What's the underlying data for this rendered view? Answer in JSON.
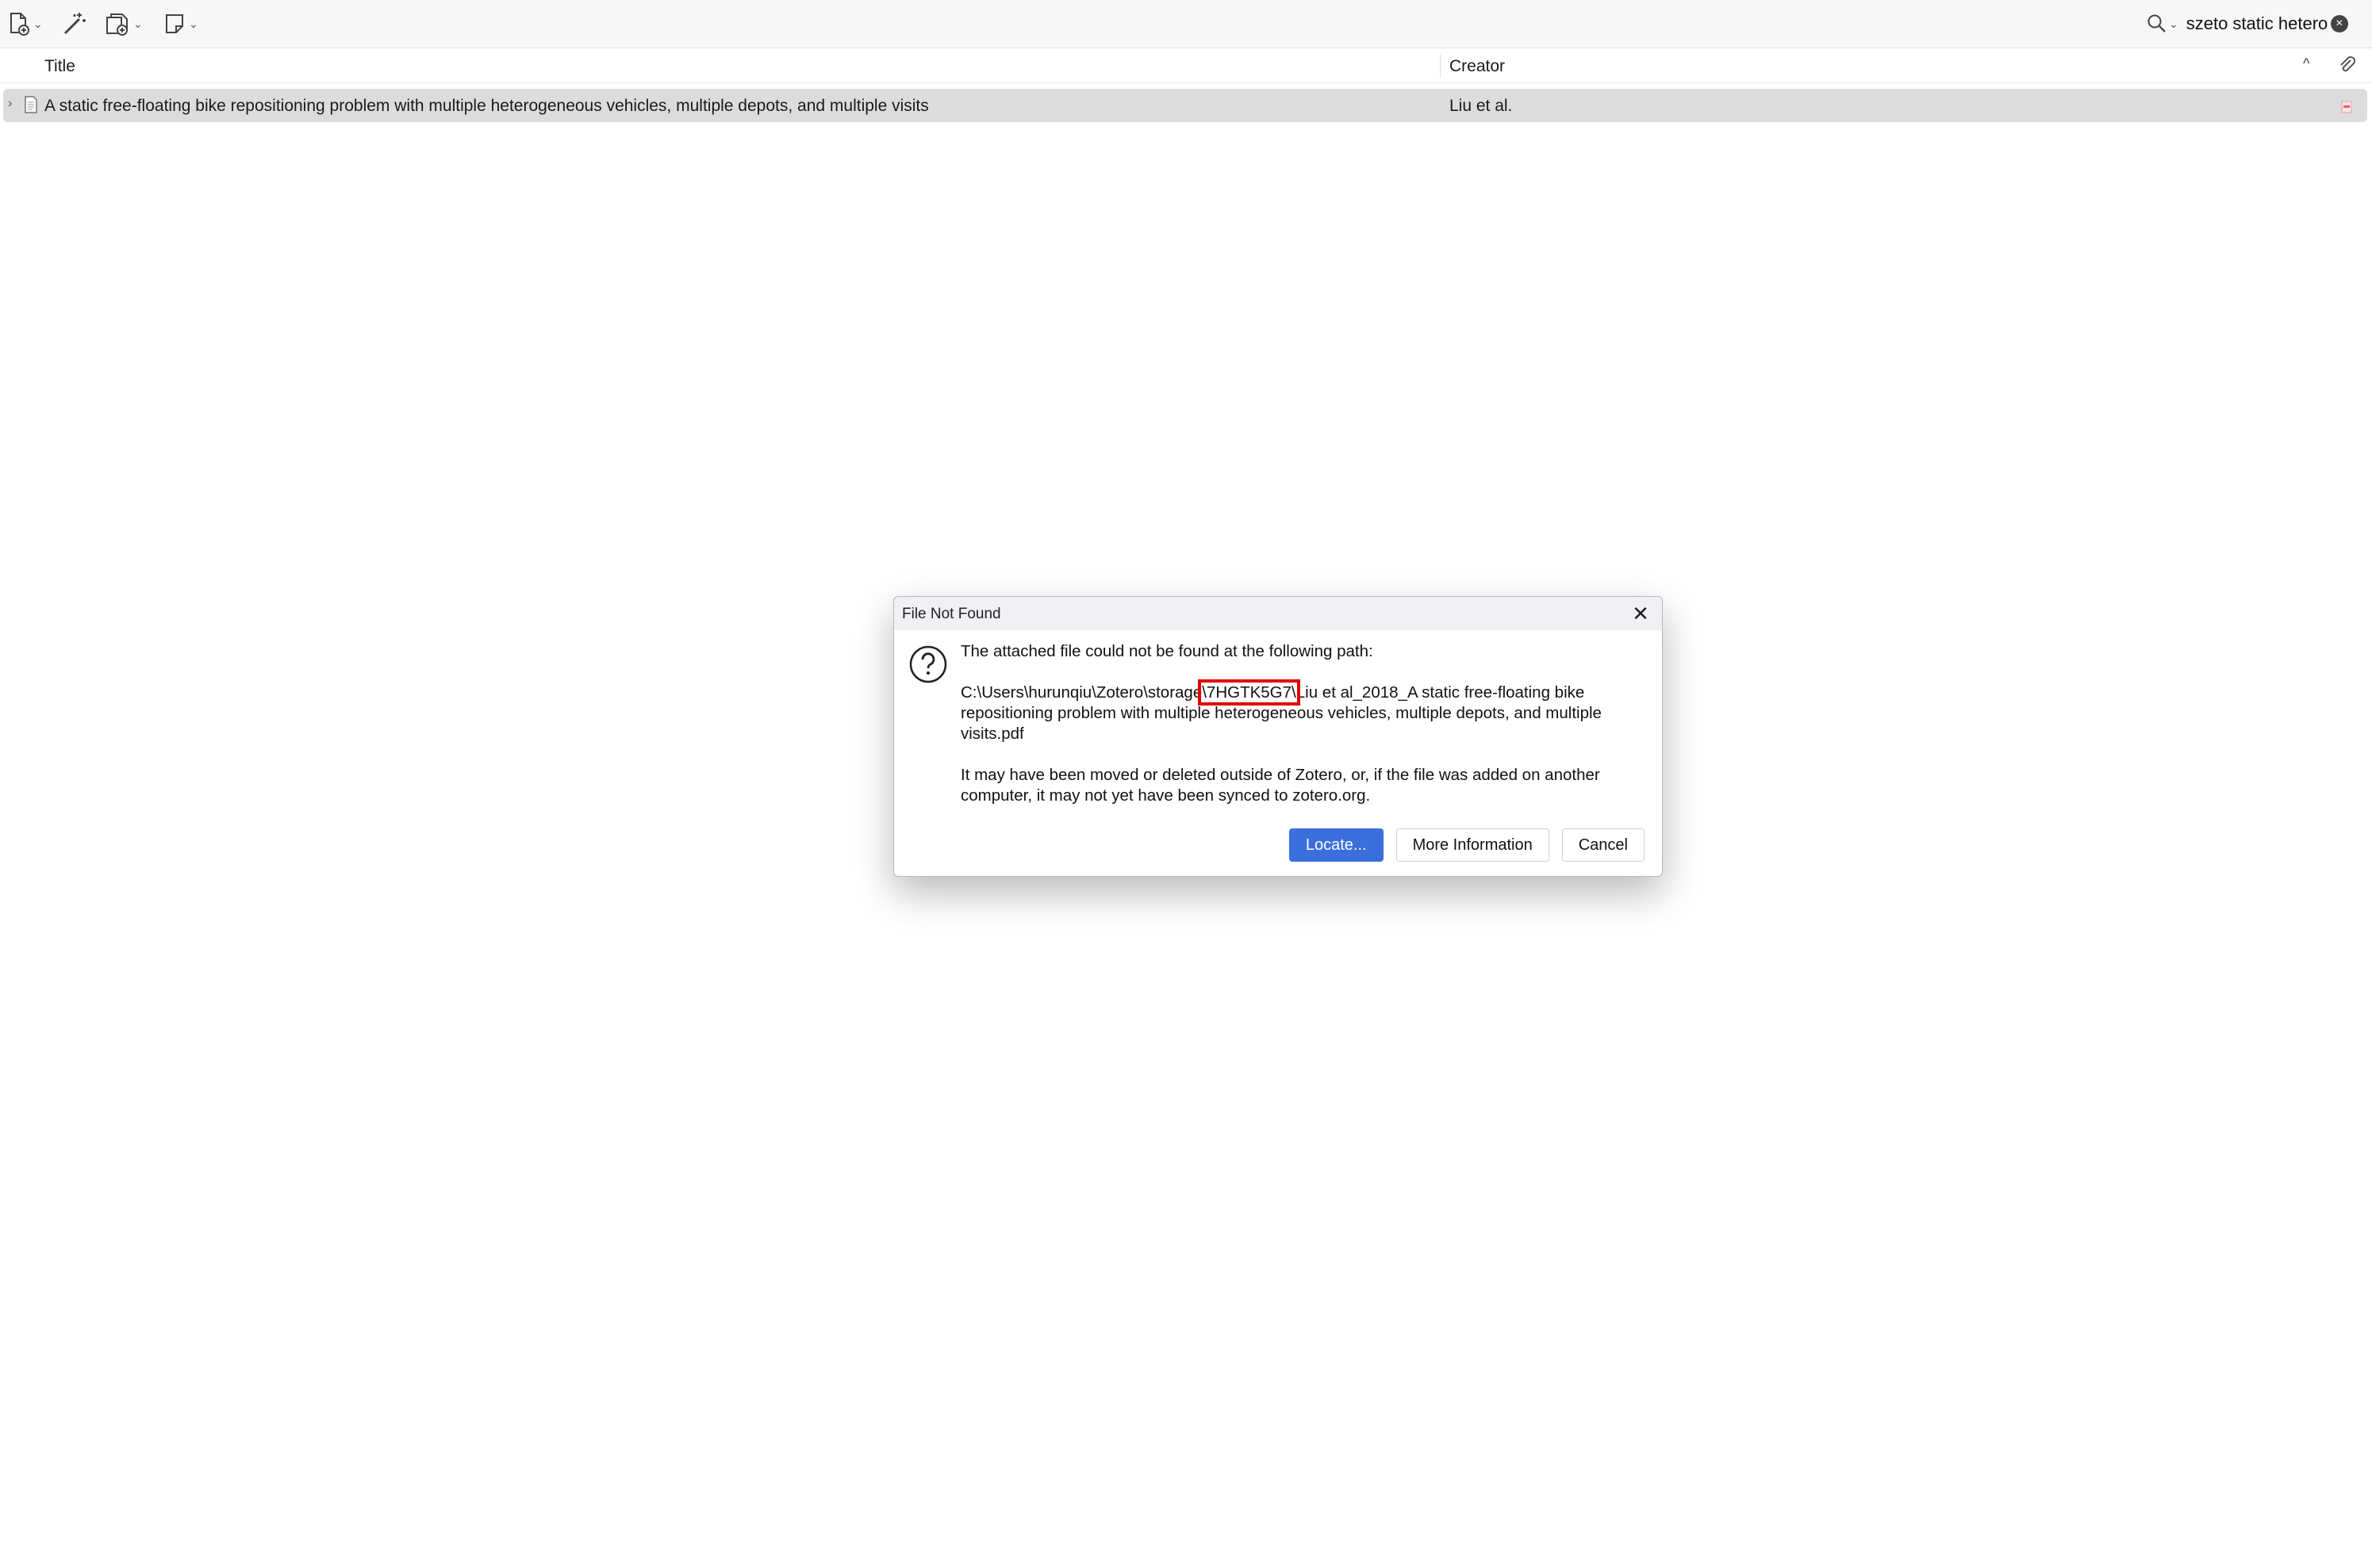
{
  "toolbar": {
    "new_item_icon": "new-item-icon",
    "magic_wand_icon": "add-by-identifier-icon",
    "new_attachment_icon": "add-attachment-icon",
    "new_note_icon": "new-note-icon",
    "search_value": "szeto static hetero"
  },
  "columns": {
    "title": "Title",
    "creator": "Creator"
  },
  "rows": [
    {
      "title": "A static free-floating bike repositioning problem with multiple heterogeneous vehicles, multiple depots, and multiple visits",
      "creator": "Liu et al."
    }
  ],
  "dialog": {
    "title": "File Not Found",
    "line1": "The attached file could not be found at the following path:",
    "path_prefix": "C:\\Users\\hurunqiu\\Zotero\\storage",
    "path_highlight": "\\7HGTK5G7\\",
    "path_suffix": "Liu et al_2018_A static free-floating bike repositioning problem with multiple heterogeneous vehicles, multiple depots, and multiple visits.pdf",
    "line3": "It may have been moved or deleted outside of Zotero, or, if the file was added on another computer, it may not yet have been synced to zotero.org.",
    "buttons": {
      "locate": "Locate...",
      "more_info": "More Information",
      "cancel": "Cancel"
    }
  },
  "colors": {
    "primary_button": "#3b6fdd",
    "highlight_box": "#e00000",
    "selected_row": "#dcdcdc"
  }
}
